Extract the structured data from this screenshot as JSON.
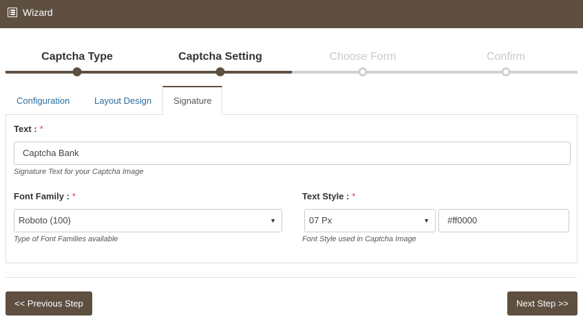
{
  "header": {
    "title": "Wizard",
    "icon": "list-icon"
  },
  "steps": [
    {
      "label": "Captcha Type",
      "state": "completed"
    },
    {
      "label": "Captcha Setting",
      "state": "current"
    },
    {
      "label": "Choose Form",
      "state": "pending"
    },
    {
      "label": "Confirm",
      "state": "pending"
    }
  ],
  "tabs": [
    {
      "label": "Configuration"
    },
    {
      "label": "Layout Design"
    },
    {
      "label": "Signature",
      "active": true
    }
  ],
  "form": {
    "text": {
      "label": "Text :",
      "required_mark": "*",
      "value": "Captcha Bank",
      "help": "Signature Text for your Captcha Image"
    },
    "font_family": {
      "label": "Font Family :",
      "required_mark": "*",
      "value": "Roboto (100)",
      "help": "Type of Font Families available"
    },
    "text_style": {
      "label": "Text Style :",
      "required_mark": "*",
      "size_value": "07 Px",
      "color_value": "#ff0000",
      "help": "Font Style used in Captcha Image"
    }
  },
  "buttons": {
    "previous": "<< Previous Step",
    "next": "Next Step >>"
  },
  "colors": {
    "brand": "#5e4f40",
    "link": "#2a6da0",
    "required": "#e04040"
  }
}
